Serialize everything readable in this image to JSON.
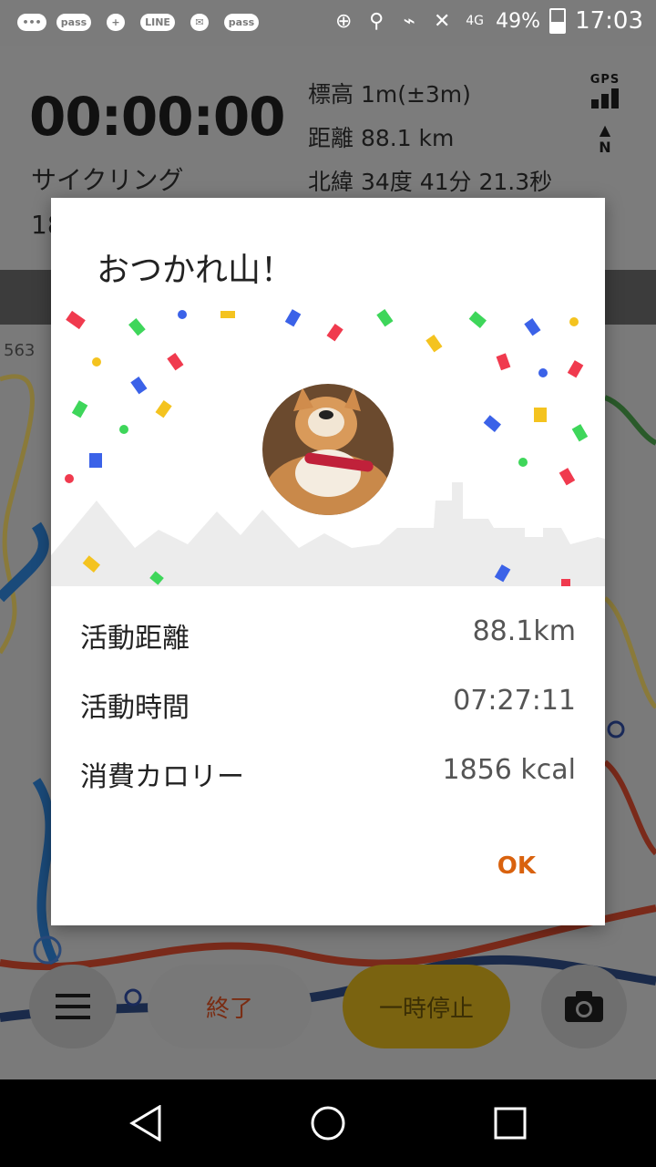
{
  "status_bar": {
    "notification_icons": [
      "message-icon",
      "pass-icon",
      "chat-add-icon",
      "line-icon",
      "mail-icon",
      "pass-card-icon"
    ],
    "line_label": "LINE",
    "pass_label": "pass",
    "network": "4G",
    "battery": "49%",
    "time": "17:03"
  },
  "background_app": {
    "elapsed_time": "00:00:00",
    "activity_type": "サイクリング",
    "elevation": "標高 1m(±3m)",
    "distance": "距離 88.1 km",
    "latitude": "北緯 34度 41分 21.3秒",
    "partial_value": "18",
    "gps_label": "GPS",
    "north_label": "N",
    "map_label": "563",
    "end_button": "終了",
    "pause_button": "一時停止"
  },
  "dialog": {
    "title": "おつかれ山！",
    "stats": [
      {
        "label": "活動距離",
        "value": "88.1km"
      },
      {
        "label": "活動時間",
        "value": "07:27:11"
      },
      {
        "label": "消費カロリー",
        "value": "1856 kcal"
      }
    ],
    "ok_button": "OK"
  },
  "colors": {
    "accent": "#d9620e",
    "pause_button": "#f4c31f",
    "dialog_background": "#ffffff"
  }
}
